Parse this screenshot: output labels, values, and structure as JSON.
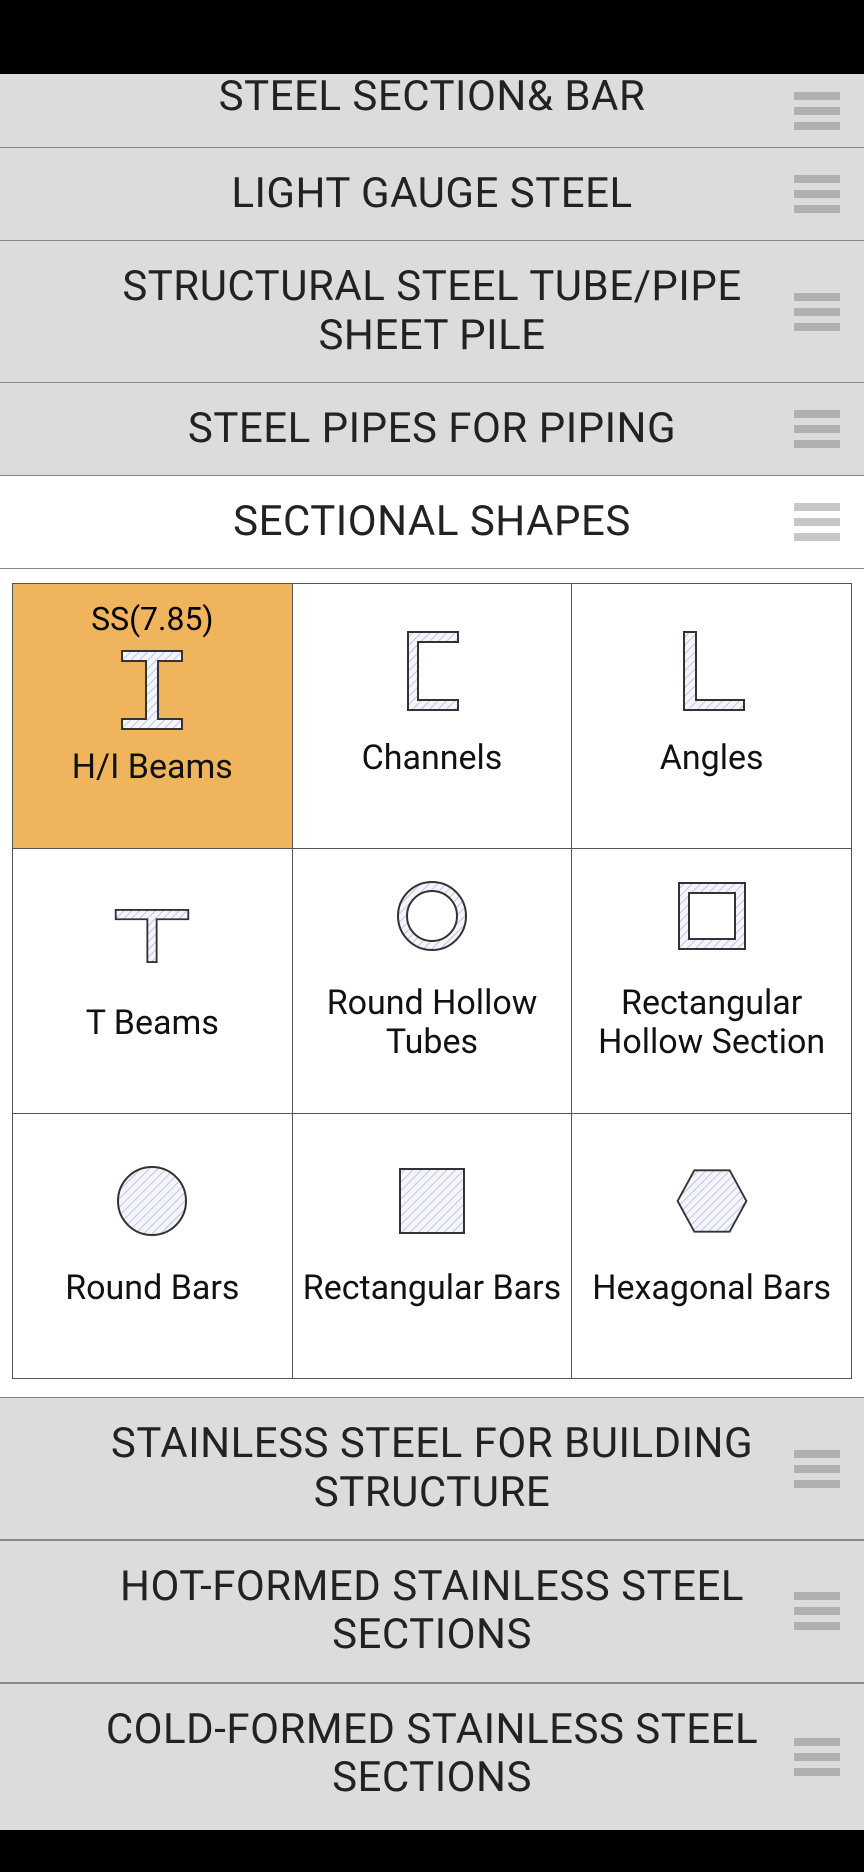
{
  "categories_top": [
    {
      "label": "STEEL SECTION& BAR",
      "partial": true
    },
    {
      "label": "LIGHT GAUGE STEEL"
    },
    {
      "label": "STRUCTURAL STEEL TUBE/PIPE SHEET PILE"
    },
    {
      "label": "STEEL PIPES FOR PIPING"
    },
    {
      "label": "SECTIONAL SHAPES",
      "active": true
    }
  ],
  "selected_badge": "SS(7.85)",
  "shapes": [
    {
      "label": "H/I Beams",
      "icon": "i-beam",
      "selected": true
    },
    {
      "label": "Channels",
      "icon": "channel"
    },
    {
      "label": "Angles",
      "icon": "angle"
    },
    {
      "label": "T Beams",
      "icon": "t-beam"
    },
    {
      "label": "Round Hollow Tubes",
      "icon": "round-hollow"
    },
    {
      "label": "Rectangular Hollow Section",
      "icon": "rect-hollow"
    },
    {
      "label": "Round Bars",
      "icon": "round-bar"
    },
    {
      "label": "Rectangular Bars",
      "icon": "rect-bar"
    },
    {
      "label": "Hexagonal Bars",
      "icon": "hex-bar"
    }
  ],
  "categories_bottom": [
    {
      "label": "STAINLESS STEEL FOR BUILDING STRUCTURE"
    },
    {
      "label": "HOT-FORMED STAINLESS STEEL SECTIONS"
    },
    {
      "label": "COLD-FORMED STAINLESS STEEL SECTIONS"
    }
  ]
}
